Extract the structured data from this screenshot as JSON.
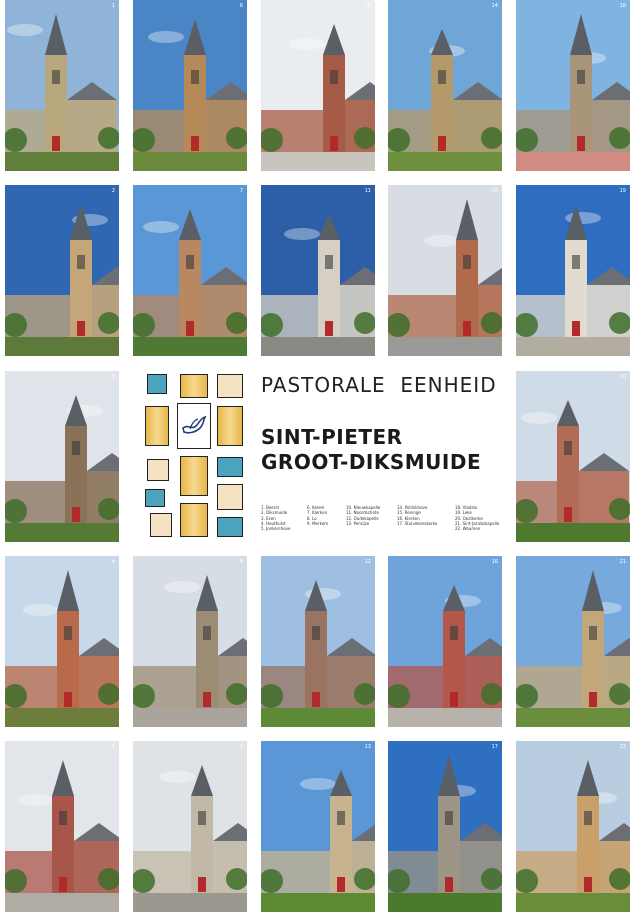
{
  "heading": {
    "line1": "PASTORALE  EENHEID",
    "line2": "SINT-PIETER",
    "line3": "GROOT-DIKSMUIDE"
  },
  "parish_list": [
    [
      "1. Beerst",
      "2. Diksmuide",
      "3. Esen",
      "4. Houthulst",
      "5. Jonkershove"
    ],
    [
      "6. Keiem",
      "7. Klerken",
      "8. Lo",
      "9. Merkem"
    ],
    [
      "10. Nieuwkapelle",
      "11. Noordschote",
      "12. Oudekapelle",
      "13. Pervijze"
    ],
    [
      "14. Pollinkhove",
      "15. Reninge",
      "16. Klerken",
      "17. Stuivekenskerke"
    ],
    [
      "18. Vladslo",
      "19. Leke",
      "20. Oostkerke",
      "21. Sint-Jacobskapelle",
      "22. Woumen"
    ]
  ],
  "tiles": [
    {
      "num": "1",
      "sky": "#8fb4d8",
      "wall": "#b9a77e",
      "ground": "#5f7f3a"
    },
    {
      "num": "6",
      "sky": "#4a86c6",
      "wall": "#b68a58",
      "ground": "#6b8a3c"
    },
    {
      "num": "10",
      "sky": "#e9edf0",
      "wall": "#a55b45",
      "ground": "#c9c5be"
    },
    {
      "num": "14",
      "sky": "#6fa6d8",
      "wall": "#b49a6a",
      "ground": "#6e8f3d"
    },
    {
      "num": "18",
      "sky": "#7fb3e0",
      "wall": "#a9957a",
      "ground": "#d08b82"
    },
    {
      "num": "2",
      "sky": "#2f67b2",
      "wall": "#c4a67a",
      "ground": "#5d7a3a"
    },
    {
      "num": "7",
      "sky": "#5a97d6",
      "wall": "#b88860",
      "ground": "#4f7a34"
    },
    {
      "num": "11",
      "sky": "#2d5fa8",
      "wall": "#d6d0c4",
      "ground": "#8a8a84"
    },
    {
      "num": "15",
      "sky": "#d8dde3",
      "wall": "#b06a4c",
      "ground": "#9a9a96"
    },
    {
      "num": "19",
      "sky": "#2e6dc0",
      "wall": "#e2dcd0",
      "ground": "#b3aca0"
    },
    {
      "num": "3",
      "sky": "#dfe4ea",
      "wall": "#8a7258",
      "ground": "#557a34"
    },
    {
      "num": "20",
      "sky": "#cfdbe6",
      "wall": "#b26c55",
      "ground": "#4e7a2f"
    },
    {
      "num": "4",
      "sky": "#c7d8ea",
      "wall": "#b86a4a",
      "ground": "#6d7e3c"
    },
    {
      "num": "8",
      "sky": "#d7dde4",
      "wall": "#9c8c74",
      "ground": "#a9a59d"
    },
    {
      "num": "12",
      "sky": "#9fbfe2",
      "wall": "#9a7460",
      "ground": "#5c8a36"
    },
    {
      "num": "16",
      "sky": "#6ea3dc",
      "wall": "#b2574a",
      "ground": "#b7b3aa"
    },
    {
      "num": "21",
      "sky": "#78a9dc",
      "wall": "#c1a77a",
      "ground": "#6a8e3e"
    },
    {
      "num": "5",
      "sky": "#e2e6ea",
      "wall": "#a9564a",
      "ground": "#b0aca4"
    },
    {
      "num": "9",
      "sky": "#dfe3e6",
      "wall": "#c2b8a6",
      "ground": "#9b9890"
    },
    {
      "num": "13",
      "sky": "#5b96d6",
      "wall": "#c7b38e",
      "ground": "#5f8a34"
    },
    {
      "num": "17",
      "sky": "#2f6fbf",
      "wall": "#9c9484",
      "ground": "#4c7a2c"
    },
    {
      "num": "22",
      "sky": "#b8cde0",
      "wall": "#c9a06a",
      "ground": "#6a8d3c"
    }
  ],
  "logo_colors": {
    "gold": "#e8b648",
    "cream": "#f4e2c2",
    "teal": "#4aa4bd",
    "border": "#222222"
  }
}
